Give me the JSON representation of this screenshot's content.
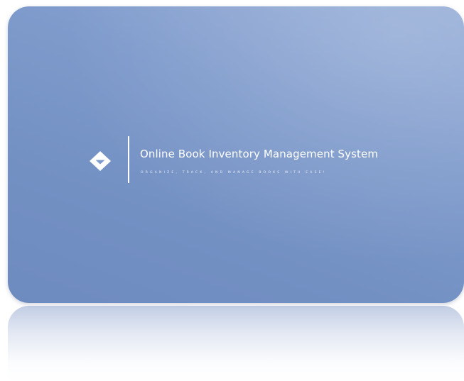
{
  "hero": {
    "title": "Online Book Inventory Management System",
    "tagline": "ORGANIZE, TRACK, AND MANAGE BOOKS WITH EASE!",
    "logo_icon": "diamond-chevron-down-icon"
  },
  "colors": {
    "card_gradient_light": "#93abd6",
    "card_gradient_dark": "#6e8bc0",
    "text": "#ffffff"
  }
}
